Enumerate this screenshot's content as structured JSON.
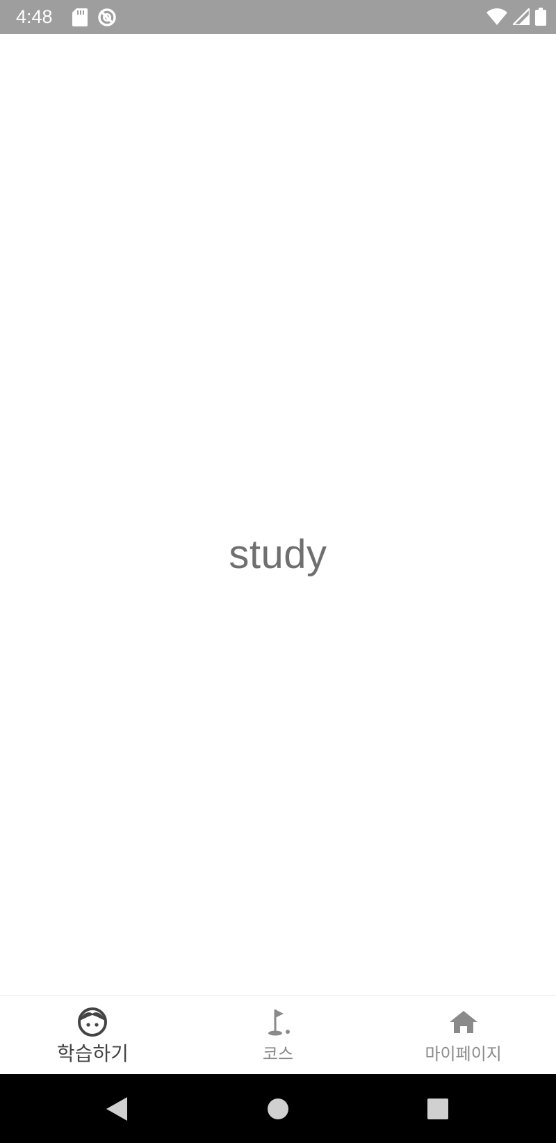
{
  "status_bar": {
    "time": "4:48",
    "left_icons": [
      "sd-card-icon",
      "sync-disabled-icon"
    ],
    "right_icons": [
      "wifi-icon",
      "cellular-signal-icon",
      "battery-icon"
    ]
  },
  "main": {
    "center_text": "study"
  },
  "bottom_nav": {
    "items": [
      {
        "label": "학습하기",
        "icon": "face-icon",
        "active": true
      },
      {
        "label": "코스",
        "icon": "golf-course-icon",
        "active": false
      },
      {
        "label": "마이페이지",
        "icon": "home-icon",
        "active": false
      }
    ]
  },
  "system_nav": {
    "buttons": [
      "back-icon",
      "home-circle-icon",
      "recents-icon"
    ]
  },
  "colors": {
    "status_bar": "#9e9e9e",
    "active_label": "#444444",
    "inactive_label": "#8a8a8a",
    "center_text": "#6f6f6f"
  }
}
